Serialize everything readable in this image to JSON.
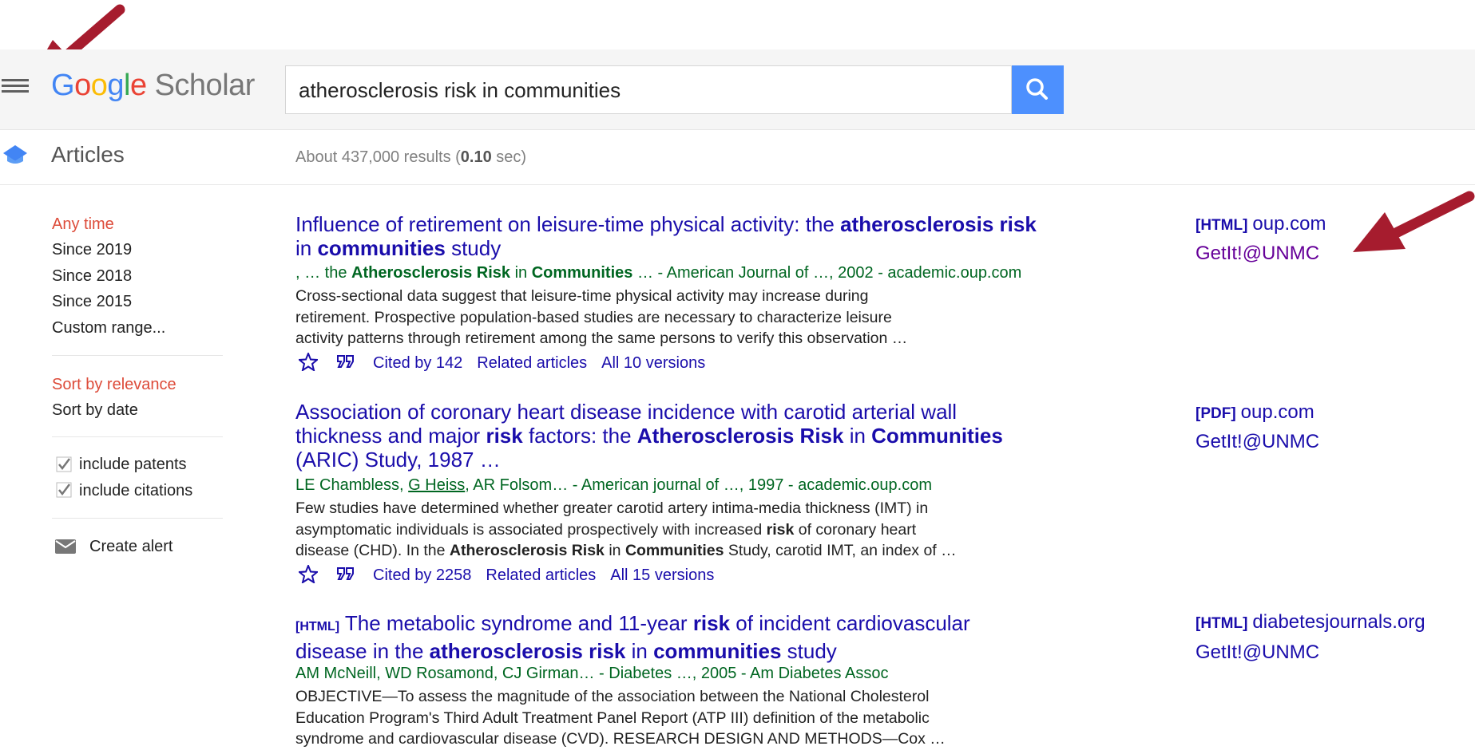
{
  "header": {
    "logo_google": [
      "G",
      "o",
      "o",
      "g",
      "l",
      "e"
    ],
    "logo_scholar": "Scholar",
    "search_value": "atherosclerosis risk in communities"
  },
  "subheader": {
    "section": "Articles",
    "results_prefix": "About 437,000 results (",
    "results_time": "0.10",
    "results_suffix": " sec)"
  },
  "sidebar": {
    "time_filters": [
      "Any time",
      "Since 2019",
      "Since 2018",
      "Since 2015",
      "Custom range..."
    ],
    "sort_options": [
      "Sort by relevance",
      "Sort by date"
    ],
    "checkboxes": [
      "include patents",
      "include citations"
    ],
    "create_alert": "Create alert"
  },
  "results": [
    {
      "title_parts": [
        "Influence of retirement on leisure-time physical activity: the ",
        "atherosclerosis risk",
        " in ",
        "communities",
        " study"
      ],
      "meta_parts": [
        ", … the ",
        "Atherosclerosis Risk",
        " in ",
        "Communities",
        " … - American Journal of …, 2002 - academic.oup.com"
      ],
      "snippet": [
        "Cross-sectional data suggest that leisure-time physical activity may increase during",
        "retirement. Prospective population-based studies are necessary to characterize leisure",
        "activity patterns through retirement among the same persons to verify this observation …"
      ],
      "cited_by": "Cited by 142",
      "related": "Related articles",
      "versions": "All 10 versions",
      "side_tag": "[HTML]",
      "side_domain": "oup.com",
      "getit": "GetIt!@UNMC"
    },
    {
      "title_parts": [
        "Association of coronary heart disease incidence with carotid arterial wall",
        "thickness and major ",
        "risk",
        " factors: the ",
        "Atherosclerosis Risk",
        " in ",
        "Communities",
        "(ARIC) Study, 1987 …"
      ],
      "meta_parts": [
        "LE Chambless, ",
        "G Heiss",
        ", AR Folsom… - American journal of …, 1997 - academic.oup.com"
      ],
      "snippet_parts": [
        "Few studies have determined whether greater carotid artery intima-media thickness (IMT) in",
        "asymptomatic individuals is associated prospectively with increased ",
        "risk",
        " of coronary heart",
        "disease (CHD). In the ",
        "Atherosclerosis Risk",
        " in ",
        "Communities",
        " Study, carotid IMT, an index of …"
      ],
      "cited_by": "Cited by 2258",
      "related": "Related articles",
      "versions": "All 15 versions",
      "side_tag": "[PDF]",
      "side_domain": "oup.com",
      "getit": "GetIt!@UNMC"
    },
    {
      "tag": "[HTML]",
      "title_parts": [
        " The metabolic syndrome and 11-year ",
        "risk",
        " of incident cardiovascular",
        "disease in the ",
        "atherosclerosis risk",
        " in ",
        "communities",
        " study"
      ],
      "meta": "AM McNeill, WD Rosamond, CJ Girman… - Diabetes …, 2005 - Am Diabetes Assoc",
      "snippet": [
        "OBJECTIVE—To assess the magnitude of the association between the National Cholesterol",
        "Education Program's Third Adult Treatment Panel Report (ATP III) definition of the metabolic",
        "syndrome and cardiovascular disease (CVD). RESEARCH DESIGN AND METHODS—Cox …"
      ],
      "side_tag": "[HTML]",
      "side_domain": "diabetesjournals.org",
      "getit": "GetIt!@UNMC"
    }
  ],
  "colors": {
    "link": "#1a0dab",
    "visited": "#660099",
    "meta_green": "#006621",
    "selected_red": "#dd4b39",
    "search_blue": "#4d90fe",
    "arrow": "#a61c2e"
  }
}
